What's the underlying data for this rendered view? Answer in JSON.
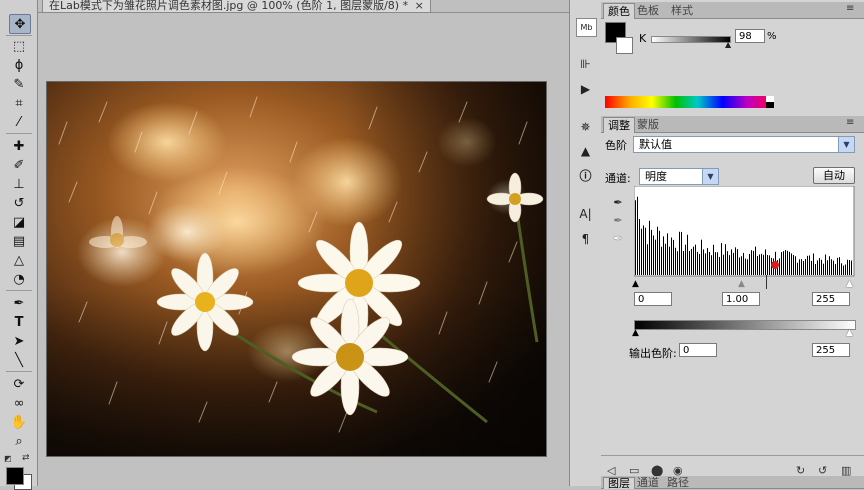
{
  "document": {
    "tab_title": "在Lab模式下为雏花照片调色素材图.jpg @ 100% (色阶 1, 图层蒙版/8) *",
    "close_label": "×"
  },
  "toolbar": {
    "tools": [
      "move",
      "marquee",
      "lasso",
      "quick-select",
      "crop",
      "eyedropper",
      "healing",
      "brush",
      "stamp",
      "history-brush",
      "eraser",
      "gradient",
      "blur",
      "dodge",
      "pen",
      "type",
      "path-select",
      "shape",
      "3d-rotate",
      "3d-orbit",
      "hand",
      "zoom"
    ],
    "foreground_color": "#000000",
    "background_color": "#ffffff"
  },
  "color_panel": {
    "tabs": [
      "颜色",
      "色板",
      "样式"
    ],
    "active_tab": "颜色",
    "channel_label": "K",
    "value": "98",
    "unit": "%",
    "slider_value_percent": 98
  },
  "adjust_panel": {
    "tabs": [
      "调整",
      "蒙版"
    ],
    "active_tab": "调整",
    "adjustment_name": "色阶",
    "preset_value": "默认值",
    "channel_label": "通道:",
    "channel_value": "明度",
    "auto_button": "自动",
    "input_black": "0",
    "input_gamma": "1.00",
    "input_white": "255",
    "output_label": "输出色阶:",
    "output_black": "0",
    "output_white": "255"
  },
  "bottom_tabs": [
    "图层",
    "通道",
    "路径"
  ],
  "colors": {
    "accent_red": "#d81c1c",
    "panel_bg": "#d4d4d4"
  }
}
